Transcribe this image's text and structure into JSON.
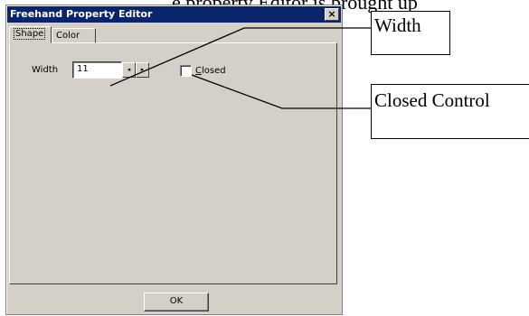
{
  "background": {
    "text": "e property Editor is brought up"
  },
  "window": {
    "title": "Freehand Property Editor",
    "close_glyph": "×",
    "tabs": [
      {
        "label": "Shape",
        "selected": true
      },
      {
        "label": "Color",
        "selected": false
      }
    ],
    "shape_tab": {
      "width_label": "Width",
      "width_value": "11",
      "spin_left_glyph": "◂",
      "spin_right_glyph": "▸",
      "closed_label_accel": "C",
      "closed_label_rest": "losed",
      "closed_checked": false
    },
    "ok_label": "OK"
  },
  "callouts": {
    "width": "Width",
    "closed": "Closed Control"
  },
  "colors": {
    "titlebar": "#0a246a",
    "dialog_face": "#d4d0c8"
  }
}
